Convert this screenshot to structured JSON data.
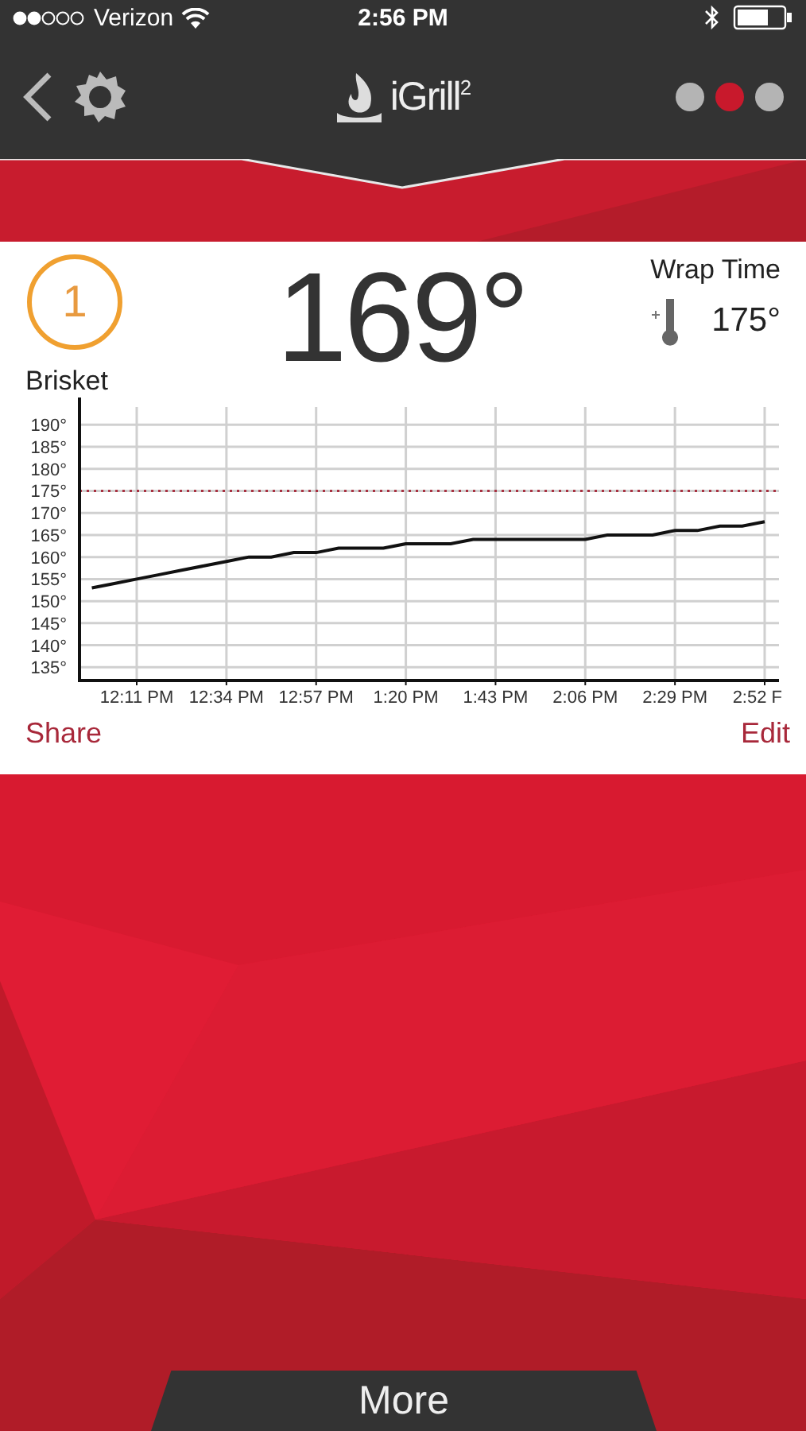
{
  "status_bar": {
    "carrier": "Verizon",
    "time": "2:56 PM"
  },
  "nav": {
    "title": "iGrill",
    "title_sup": "2",
    "pages": [
      {
        "selected": false
      },
      {
        "selected": true
      },
      {
        "selected": false
      }
    ]
  },
  "probe": {
    "number": "1",
    "name": "Brisket",
    "temperature": "169°",
    "alarm_label": "Wrap Time",
    "alarm_temperature": "175°"
  },
  "chart_data": {
    "type": "line",
    "ylim": [
      132,
      194
    ],
    "categories": [
      null,
      null,
      "12:11 PM",
      null,
      null,
      null,
      "12:34 PM",
      null,
      null,
      null,
      "12:57 PM",
      null,
      null,
      null,
      "1:20 PM",
      null,
      null,
      null,
      "1:43 PM",
      null,
      null,
      null,
      "2:06 PM",
      null,
      null,
      null,
      "2:29 PM",
      null,
      null,
      null,
      "2:52 F"
    ],
    "yticks": [
      {
        "value": 135,
        "label": "135°"
      },
      {
        "value": 140,
        "label": "140°"
      },
      {
        "value": 145,
        "label": "145°"
      },
      {
        "value": 150,
        "label": "150°"
      },
      {
        "value": 155,
        "label": "155°"
      },
      {
        "value": 160,
        "label": "160°"
      },
      {
        "value": 165,
        "label": "165°"
      },
      {
        "value": 170,
        "label": "170°"
      },
      {
        "value": 175,
        "label": "175°"
      },
      {
        "value": 180,
        "label": "180°"
      },
      {
        "value": 185,
        "label": "185°"
      },
      {
        "value": 190,
        "label": "190°"
      }
    ],
    "series": [
      {
        "color": "#111111",
        "values": [
          153,
          154,
          155,
          156,
          157,
          158,
          159,
          160,
          160,
          161,
          161,
          162,
          162,
          162,
          163,
          163,
          163,
          164,
          164,
          164,
          164,
          164,
          164,
          165,
          165,
          165,
          166,
          166,
          167,
          167,
          168
        ]
      }
    ],
    "ref_lines": [
      {
        "axis": "y",
        "value": 175
      }
    ],
    "grid": true
  },
  "actions": {
    "share": "Share",
    "edit": "Edit"
  },
  "footer": {
    "more": "More"
  }
}
